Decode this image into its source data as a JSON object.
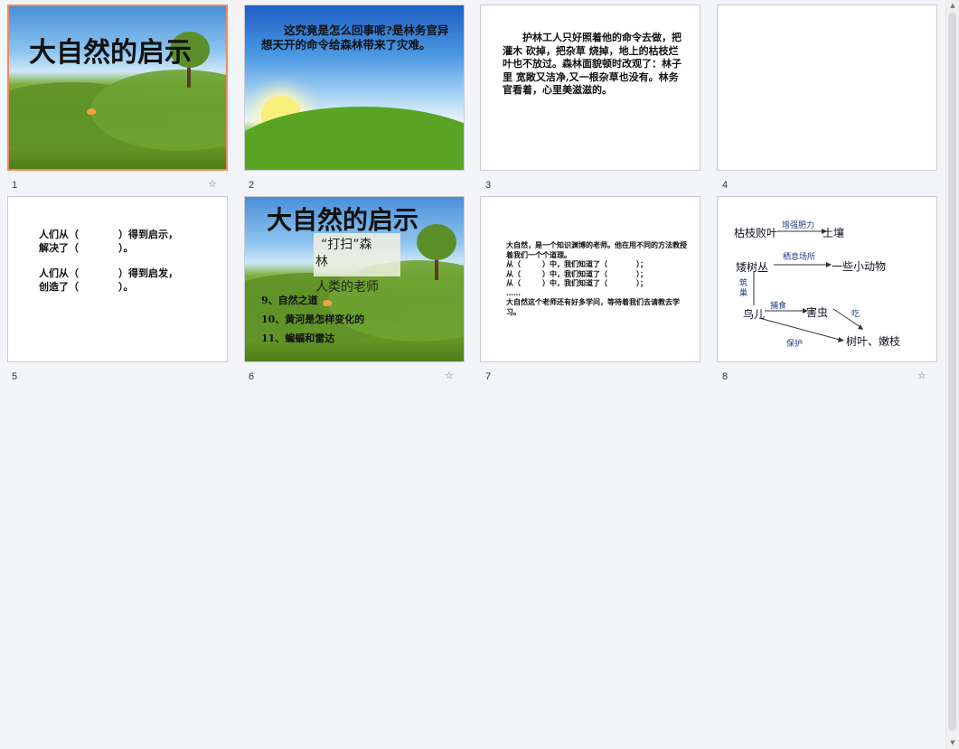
{
  "slides": [
    {
      "number": "1",
      "title": "大自然的启示",
      "has_star": true,
      "selected": true
    },
    {
      "number": "2",
      "text": "这究竟是怎么回事呢?是林务官异想天开的命令给森林带来了灾难。"
    },
    {
      "number": "3",
      "paragraph": "护林工人只好照着他的命令去做，把灌木 砍掉，把杂草 烧掉，地上的枯枝烂叶也不放过。森林面貌顿时改观了：林子里 宽敞又洁净,又一根杂草也没有。林务官看着，心里美滋滋的。"
    },
    {
      "number": "4"
    },
    {
      "number": "5",
      "lines": [
        "人们从（　　　　）得到启示，",
        "解决了（　　　　）。",
        "人们从（　　　　）得到启发，",
        "创造了（　　　　）。"
      ]
    },
    {
      "number": "6",
      "title": "大自然的启示",
      "box_line1": "“打扫”森",
      "box_line2": "林",
      "subtitle": "人类的老师",
      "items": [
        "9、自然之道",
        "10、黄河是怎样变化的",
        "11、蝙蝠和雷达"
      ],
      "has_star": true
    },
    {
      "number": "7",
      "text": "大自然，是一个知识渊博的老师。他在用不同的方法教授着我们一个个道理。\n从（　　　）中，我们知道了（　　　　）；\n从（　　　）中，我们知道了（　　　　）；\n从（　　　）中，我们知道了（　　　　）；\n……\n大自然这个老师还有好多学问，等待着我们去请教去学习。"
    },
    {
      "number": "8",
      "has_star": true,
      "diagram": {
        "n_kuzhi": "枯枝败叶",
        "n_turang": "土壤",
        "e_zengqiang": "增强肥力",
        "n_aishu": "矮树丛",
        "n_xiaodongwu": "一些小动物",
        "e_qixi": "栖息场所",
        "e_zhuchao": "筑巢",
        "n_niao": "鸟儿",
        "n_haichong": "害虫",
        "e_bushi": "捕食",
        "e_chi": "吃",
        "n_shuye": "树叶、嫩枝",
        "e_baohu": "保护"
      }
    }
  ],
  "icons": {
    "star": "☆",
    "scroll_up": "▲",
    "scroll_down": "▼"
  }
}
